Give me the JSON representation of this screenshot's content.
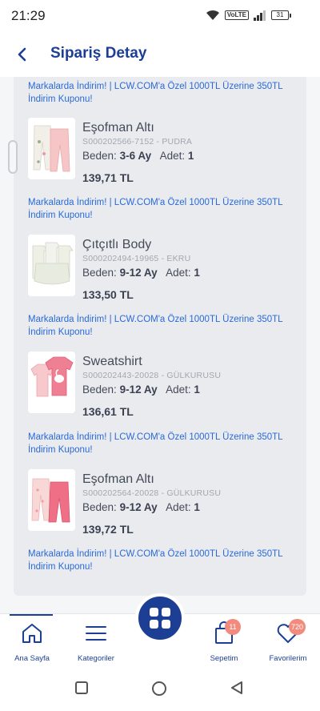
{
  "status_bar": {
    "time": "21:29",
    "volte": "VoLTE",
    "battery": "31"
  },
  "header": {
    "title": "Sipariş Detay"
  },
  "promo_text": "Markalarda İndirim! | LCW.COM'a Özel 1000TL Üzerine 350TL İndirim Kuponu!",
  "labels": {
    "size": "Beden:",
    "quantity": "Adet:"
  },
  "items": [
    {
      "name": "Eşofman Altı",
      "code": "S000202566-7152 - PUDRA",
      "size": "3-6 Ay",
      "qty": "1",
      "price": "139,71 TL"
    },
    {
      "name": "Çıtçıtlı Body",
      "code": "S000202494-19965 - EKRU",
      "size": "9-12 Ay",
      "qty": "1",
      "price": "133,50 TL"
    },
    {
      "name": "Sweatshirt",
      "code": "S000202443-20028 - GÜLKURUSU",
      "size": "9-12 Ay",
      "qty": "1",
      "price": "136,61 TL"
    },
    {
      "name": "Eşofman Altı",
      "code": "S000202564-20028 - GÜLKURUSU",
      "size": "9-12 Ay",
      "qty": "1",
      "price": "139,72 TL"
    }
  ],
  "bottom_nav": {
    "home": "Ana Sayfa",
    "categories": "Kategoriler",
    "cart": "Sepetim",
    "cart_count": "11",
    "favorites": "Favorilerim",
    "favorites_count": "720"
  },
  "colors": {
    "brand": "#1c3f95",
    "link": "#2a6ad8",
    "badge": "#f28b7d",
    "card": "#e9ebef"
  }
}
